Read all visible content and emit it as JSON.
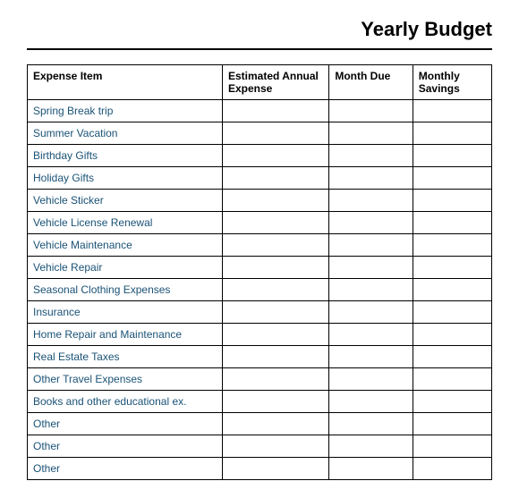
{
  "header": {
    "title": "Yearly Budget"
  },
  "table": {
    "columns": [
      {
        "key": "expense",
        "label": "Expense Item"
      },
      {
        "key": "annual",
        "label": "Estimated Annual Expense"
      },
      {
        "key": "month",
        "label": "Month Due"
      },
      {
        "key": "savings",
        "label": "Monthly Savings"
      }
    ],
    "rows": [
      {
        "expense": "Spring Break trip",
        "annual": "",
        "month": "",
        "savings": ""
      },
      {
        "expense": "Summer Vacation",
        "annual": "",
        "month": "",
        "savings": ""
      },
      {
        "expense": "Birthday Gifts",
        "annual": "",
        "month": "",
        "savings": ""
      },
      {
        "expense": "Holiday Gifts",
        "annual": "",
        "month": "",
        "savings": ""
      },
      {
        "expense": "Vehicle Sticker",
        "annual": "",
        "month": "",
        "savings": ""
      },
      {
        "expense": "Vehicle License Renewal",
        "annual": "",
        "month": "",
        "savings": ""
      },
      {
        "expense": "Vehicle Maintenance",
        "annual": "",
        "month": "",
        "savings": ""
      },
      {
        "expense": "Vehicle Repair",
        "annual": "",
        "month": "",
        "savings": ""
      },
      {
        "expense": "Seasonal Clothing Expenses",
        "annual": "",
        "month": "",
        "savings": ""
      },
      {
        "expense": "Insurance",
        "annual": "",
        "month": "",
        "savings": ""
      },
      {
        "expense": "Home Repair and Maintenance",
        "annual": "",
        "month": "",
        "savings": ""
      },
      {
        "expense": "Real Estate Taxes",
        "annual": "",
        "month": "",
        "savings": ""
      },
      {
        "expense": "Other Travel Expenses",
        "annual": "",
        "month": "",
        "savings": ""
      },
      {
        "expense": "Books and other educational ex.",
        "annual": "",
        "month": "",
        "savings": ""
      },
      {
        "expense": "Other",
        "annual": "",
        "month": "",
        "savings": ""
      },
      {
        "expense": "Other",
        "annual": "",
        "month": "",
        "savings": ""
      },
      {
        "expense": "Other",
        "annual": "",
        "month": "",
        "savings": ""
      }
    ]
  }
}
